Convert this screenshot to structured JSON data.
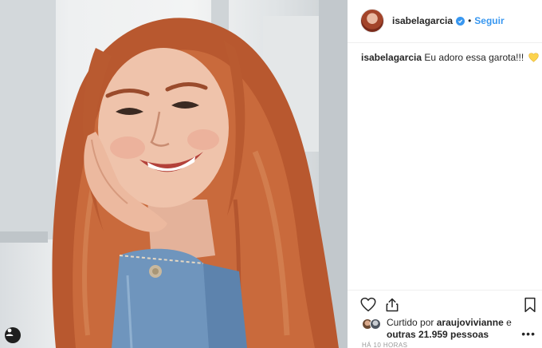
{
  "post": {
    "username": "isabelagarcia",
    "verified_icon": "verified-badge-icon",
    "separator": "•",
    "follow_label": "Seguir",
    "caption_text": "Eu adoro essa garota!!!",
    "caption_emoji": "yellow-heart-icon",
    "likes_prefix": "Curtido por",
    "likes_user": "araujovivianne",
    "likes_conjunction": "e",
    "likes_others": "outras 21.959 pessoas",
    "more_label": "•••",
    "timestamp": "HÁ 10 HORAS"
  },
  "icons": {
    "like": "heart-outline-icon",
    "share": "share-icon",
    "save": "bookmark-icon",
    "account": "user-account-icon"
  },
  "colors": {
    "link_blue": "#3897f0",
    "text": "#262626",
    "muted": "#999999",
    "divider": "#efefef",
    "emoji_yellow": "#fcd34d"
  }
}
